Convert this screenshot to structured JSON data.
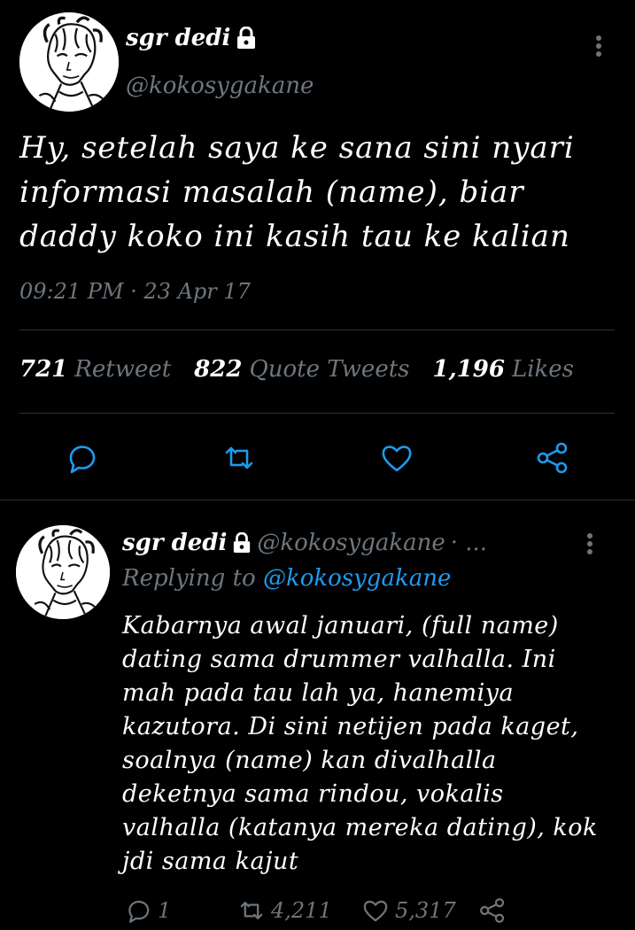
{
  "main_tweet": {
    "author_name": "sgr dedi",
    "handle": "@kokosygakane",
    "text": "Hy, setelah saya ke sana sini nyari informasi masalah (name), biar daddy koko ini kasih tau ke kalian",
    "timestamp": "09:21 PM · 23 Apr 17",
    "stats": {
      "retweets": "721",
      "retweets_label": "Retweet",
      "quotes": "822",
      "quotes_label": "Quote Tweets",
      "likes": "1,196",
      "likes_label": "Likes"
    },
    "actions": [
      "reply-icon",
      "retweet-icon",
      "like-icon",
      "share-icon"
    ]
  },
  "reply_tweet": {
    "author_name": "sgr dedi",
    "handle": "@kokosygakane",
    "meta_suffix": "· ...",
    "replying_to_label": "Replying to",
    "replying_to_handle": "@kokosygakane",
    "text": "Kabarnya awal januari, (full name) dating sama drummer valhalla. Ini mah pada tau lah ya, hanemiya kazutora. Di sini netijen pada kaget, soalnya (name) kan divalhalla deketnya sama rindou, vokalis valhalla (katanya mereka dating), kok jdi sama kajut",
    "replies": "1",
    "retweets": "4,211",
    "likes": "5,317"
  },
  "colors": {
    "background": "#000000",
    "muted": "#6e767d",
    "link": "#1d9bf0",
    "divider": "#2f3336"
  }
}
